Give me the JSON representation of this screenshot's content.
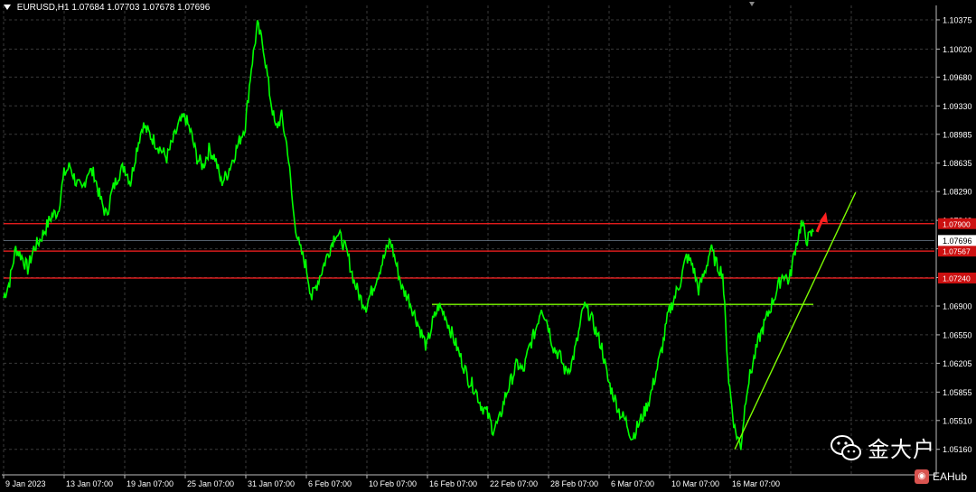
{
  "header": {
    "symbol": "EURUSD,H1",
    "ohlc": "1.07684 1.07703 1.07678 1.07696"
  },
  "watermark": {
    "text": "金大户",
    "icon": "wechat-icon",
    "badge_text": "EAHub",
    "badge_icon": "weibo-icon"
  },
  "colors": {
    "background": "#000000",
    "grid": "#3a3a3a",
    "price_line": "#00ff00",
    "support_line": "#7cfc00",
    "resistance_line": "#ff2020",
    "arrow": "#ff2020",
    "axis_text": "#ffffff"
  },
  "chart_data": {
    "type": "line",
    "title": "EURUSD,H1",
    "y_axis": {
      "range": [
        1.0485,
        1.1055
      ],
      "ticks": [
        "1.10375",
        "1.10020",
        "1.09680",
        "1.09330",
        "1.08985",
        "1.08635",
        "1.08290",
        "1.07940",
        "1.07595",
        "1.07245",
        "1.06900",
        "1.06550",
        "1.06205",
        "1.05855",
        "1.05510",
        "1.05160"
      ]
    },
    "x_axis": {
      "ticks": [
        "9 Jan 2023",
        "13 Jan 07:00",
        "19 Jan 07:00",
        "25 Jan 07:00",
        "31 Jan 07:00",
        "6 Feb 07:00",
        "10 Feb 07:00",
        "16 Feb 07:00",
        "22 Feb 07:00",
        "28 Feb 07:00",
        "6 Mar 07:00",
        "10 Mar 07:00",
        "16 Mar 07:00"
      ]
    },
    "current_price": "1.07696",
    "price_labels": [
      {
        "value": 1.079,
        "text": "1.07900"
      },
      {
        "value": 1.07567,
        "text": "1.07567"
      },
      {
        "value": 1.0724,
        "text": "1.07240"
      }
    ],
    "horizontal_lines": [
      {
        "value": 1.079,
        "color": "#ff2020"
      },
      {
        "value": 1.07567,
        "color": "#ff2020"
      },
      {
        "value": 1.0724,
        "color": "#ff2020"
      },
      {
        "value": 1.0692,
        "color": "#7cfc00",
        "from_date": "16 Feb 07:00"
      }
    ],
    "series": [
      {
        "values": [
          1.07,
          1.072,
          1.076,
          1.075,
          1.0735,
          1.076,
          1.077,
          1.0785,
          1.08,
          1.0805,
          1.085,
          1.086,
          1.084,
          1.083,
          1.0855,
          1.085,
          1.082,
          1.08,
          1.083,
          1.085,
          1.086,
          1.084,
          1.088,
          1.091,
          1.09,
          1.089,
          1.088,
          1.087,
          1.089,
          1.091,
          1.092,
          1.09,
          1.087,
          1.086,
          1.088,
          1.087,
          1.084,
          1.085,
          1.087,
          1.089,
          1.091,
          1.098,
          1.103,
          1.1005,
          1.095,
          1.0905,
          1.092,
          1.088,
          1.08,
          1.076,
          1.074,
          1.07,
          1.072,
          1.074,
          1.076,
          1.078,
          1.077,
          1.075,
          1.072,
          1.07,
          1.069,
          1.071,
          1.073,
          1.075,
          1.077,
          1.074,
          1.071,
          1.07,
          1.068,
          1.066,
          1.064,
          1.067,
          1.069,
          1.068,
          1.066,
          1.064,
          1.062,
          1.06,
          1.059,
          1.057,
          1.056,
          1.054,
          1.055,
          1.058,
          1.06,
          1.062,
          1.061,
          1.064,
          1.066,
          1.069,
          1.067,
          1.064,
          1.063,
          1.061,
          1.062,
          1.065,
          1.069,
          1.068,
          1.066,
          1.064,
          1.06,
          1.058,
          1.056,
          1.055,
          1.053,
          1.0545,
          1.056,
          1.058,
          1.061,
          1.064,
          1.068,
          1.07,
          1.072,
          1.075,
          1.074,
          1.071,
          1.073,
          1.076,
          1.074,
          1.073,
          1.06,
          1.054,
          1.052,
          1.059,
          1.062,
          1.065,
          1.067,
          1.069,
          1.071,
          1.073,
          1.072,
          1.076,
          1.079,
          1.077,
          1.078
        ]
      }
    ],
    "trendline": {
      "from": {
        "x_index": 121,
        "value": 1.0516
      },
      "to": {
        "x_index": 141,
        "value": 1.0828
      }
    },
    "arrow": {
      "at_index": 134,
      "value": 1.078,
      "direction": "up"
    },
    "grid": true
  }
}
